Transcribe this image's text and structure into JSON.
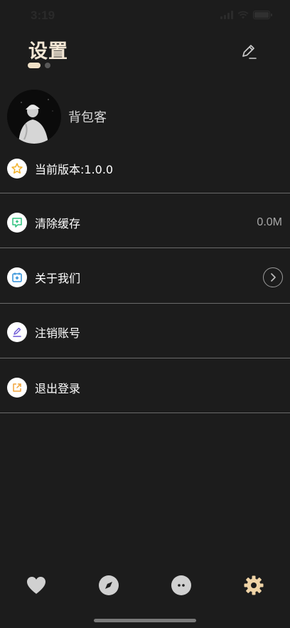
{
  "status_bar": {
    "time": "3:19"
  },
  "header": {
    "title": "设置",
    "edit_icon": "pencil-icon"
  },
  "profile": {
    "username": "背包客"
  },
  "menu": {
    "version": {
      "label": "当前版本:1.0.0",
      "icon": "star-icon",
      "color": "#f2b22b"
    },
    "clear_cache": {
      "label": "清除缓存",
      "value": "0.0M",
      "icon": "message-plus-icon",
      "color": "#2ec27e"
    },
    "about": {
      "label": "关于我们",
      "icon": "calendar-plus-icon",
      "color": "#2f8fd8"
    },
    "delete_account": {
      "label": "注销账号",
      "icon": "pen-icon",
      "color": "#6b55d6"
    },
    "logout": {
      "label": "退出登录",
      "icon": "exit-icon",
      "color": "#f0a43a"
    }
  },
  "tab_bar": {
    "tabs": [
      {
        "name": "favorites",
        "icon": "heart-icon",
        "active": false
      },
      {
        "name": "discover",
        "icon": "compass-icon",
        "active": false
      },
      {
        "name": "messages",
        "icon": "chat-icon",
        "active": false
      },
      {
        "name": "settings",
        "icon": "gear-icon",
        "active": true
      }
    ],
    "active_color": "#efd3a6",
    "inactive_color": "#d0d0d0"
  }
}
